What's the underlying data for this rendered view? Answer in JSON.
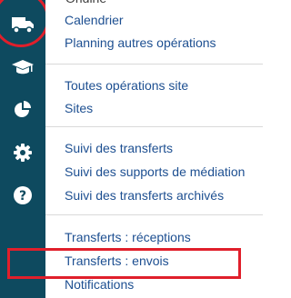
{
  "sidebar": {
    "icons": [
      {
        "name": "truck-icon"
      },
      {
        "name": "graduation-cap-icon"
      },
      {
        "name": "pie-chart-icon"
      },
      {
        "name": "gear-icon"
      },
      {
        "name": "help-icon"
      }
    ]
  },
  "menu": {
    "group1": [
      "Calendrier",
      "Planning autres opérations"
    ],
    "group2": [
      "Toutes opérations site",
      "Sites"
    ],
    "group3": [
      "Suivi des transferts",
      "Suivi des supports de médiation",
      "Suivi des transferts archivés"
    ],
    "group4": [
      "Transferts : réceptions",
      "Transferts : envois",
      "Notifications"
    ]
  },
  "colors": {
    "sidebar_bg": "#0e4a5f",
    "link": "#1d4f91",
    "annotation": "#e01f2b"
  }
}
